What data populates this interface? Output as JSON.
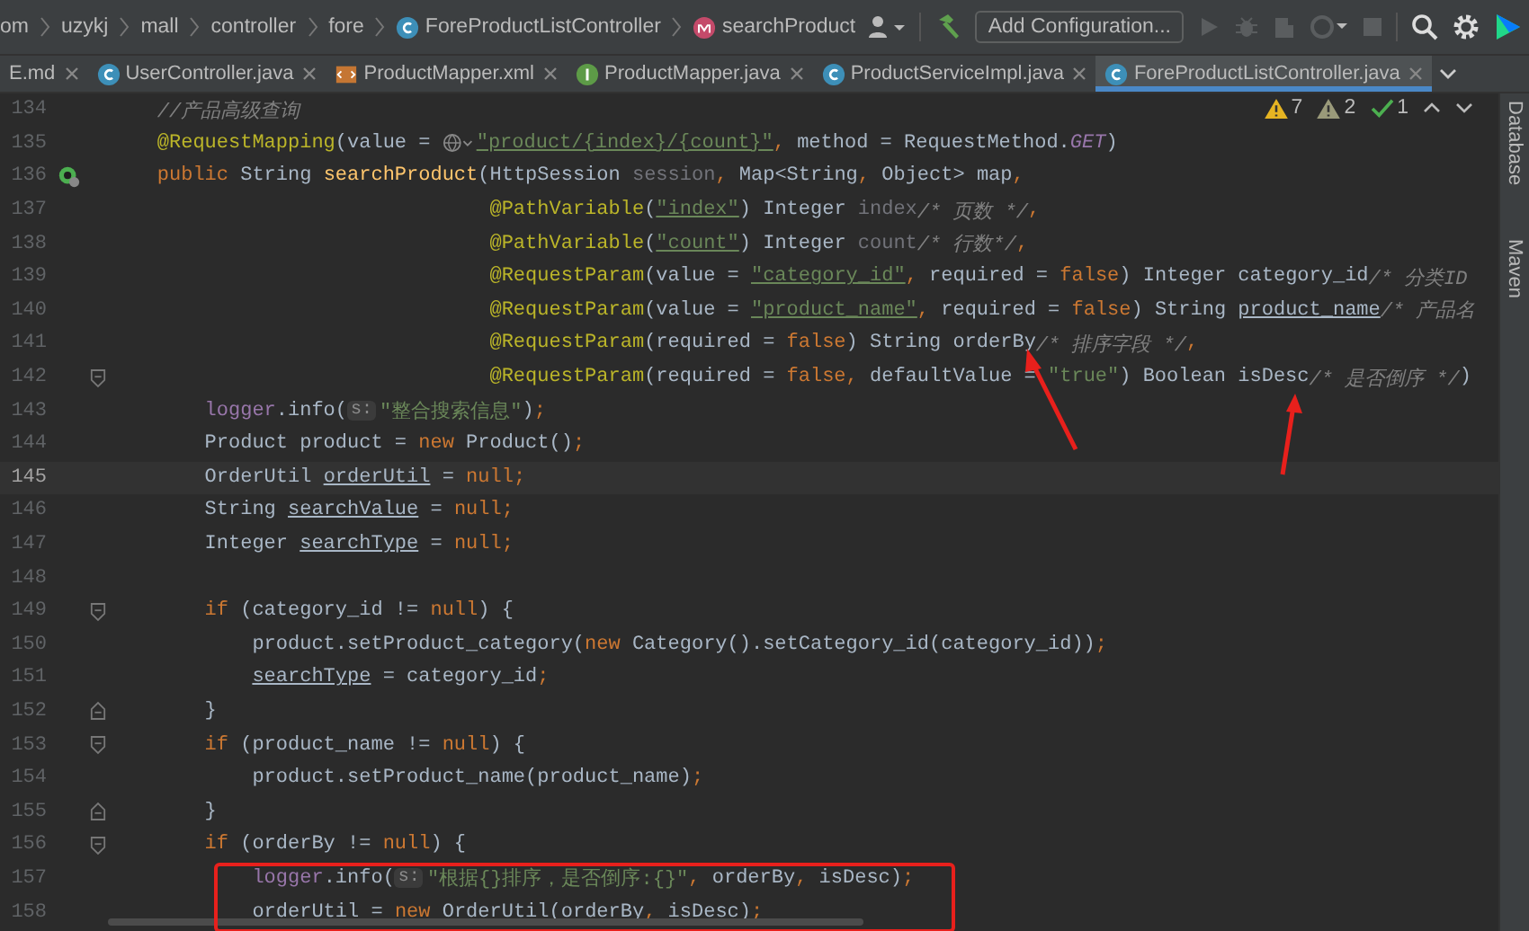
{
  "breadcrumbs": [
    {
      "text": "om",
      "kind": "folder"
    },
    {
      "text": "uzykj",
      "kind": "folder"
    },
    {
      "text": "mall",
      "kind": "folder"
    },
    {
      "text": "controller",
      "kind": "folder"
    },
    {
      "text": "fore",
      "kind": "folder"
    },
    {
      "text": "ForeProductListController",
      "kind": "class"
    },
    {
      "text": "searchProduct",
      "kind": "method"
    }
  ],
  "run_config": {
    "label": "Add Configuration..."
  },
  "tabs": [
    {
      "label": "E.md",
      "kind": "text",
      "selected": false
    },
    {
      "label": "UserController.java",
      "kind": "class",
      "selected": false
    },
    {
      "label": "ProductMapper.xml",
      "kind": "xml",
      "selected": false
    },
    {
      "label": "ProductMapper.java",
      "kind": "interface",
      "selected": false
    },
    {
      "label": "ProductServiceImpl.java",
      "kind": "class",
      "selected": false
    },
    {
      "label": "ForeProductListController.java",
      "kind": "class",
      "selected": true
    }
  ],
  "inspections": [
    {
      "kind": "warning",
      "count": "7"
    },
    {
      "kind": "weak",
      "count": "2"
    },
    {
      "kind": "ok",
      "count": "1"
    }
  ],
  "side_tools": [
    "Database",
    "Maven"
  ],
  "lines": [
    {
      "number": "134",
      "current": false,
      "tokens": [
        {
          "kind": "member"
        },
        {
          "kind": "cmt",
          "text": "//产品高级查询"
        }
      ]
    },
    {
      "number": "135",
      "current": false,
      "tokens": [
        {
          "kind": "member"
        },
        {
          "kind": "ann",
          "text": "@RequestMapping"
        },
        {
          "kind": "p",
          "text": "(value = "
        },
        {
          "kind": "globe"
        },
        {
          "kind": "stru",
          "text": "\"product/{index}/{count}\""
        },
        {
          "kind": "kw",
          "text": ","
        },
        {
          "kind": "p",
          "text": " method = RequestMethod."
        },
        {
          "kind": "const",
          "text": "GET"
        },
        {
          "kind": "p",
          "text": ")"
        }
      ]
    },
    {
      "number": "136",
      "current": false,
      "kind": "bean",
      "tokens": [
        {
          "kind": "member"
        },
        {
          "kind": "kw",
          "text": "public"
        },
        {
          "kind": "p",
          "text": " String "
        },
        {
          "kind": "fn",
          "text": "searchProduct"
        },
        {
          "kind": "p",
          "text": "(HttpSession "
        },
        {
          "kind": "dim",
          "text": "session"
        },
        {
          "kind": "kw",
          "text": ","
        },
        {
          "kind": "p",
          "text": " Map<String"
        },
        {
          "kind": "kw",
          "text": ","
        },
        {
          "kind": "p",
          "text": " Object> map"
        },
        {
          "kind": "kw",
          "text": ","
        }
      ]
    },
    {
      "number": "137",
      "current": false,
      "tokens": [
        {
          "kind": "align"
        },
        {
          "kind": "ann",
          "text": "@PathVariable"
        },
        {
          "kind": "p",
          "text": "("
        },
        {
          "kind": "stru",
          "text": "\"index\""
        },
        {
          "kind": "p",
          "text": ") Integer "
        },
        {
          "kind": "dim",
          "text": "index"
        },
        {
          "kind": "cmt",
          "text": "/* 页数 */"
        },
        {
          "kind": "kw",
          "text": ","
        }
      ]
    },
    {
      "number": "138",
      "current": false,
      "tokens": [
        {
          "kind": "align"
        },
        {
          "kind": "ann",
          "text": "@PathVariable"
        },
        {
          "kind": "p",
          "text": "("
        },
        {
          "kind": "stru",
          "text": "\"count\""
        },
        {
          "kind": "p",
          "text": ") Integer "
        },
        {
          "kind": "dim",
          "text": "count"
        },
        {
          "kind": "cmt",
          "text": "/* 行数*/"
        },
        {
          "kind": "kw",
          "text": ","
        }
      ]
    },
    {
      "number": "139",
      "current": false,
      "tokens": [
        {
          "kind": "align"
        },
        {
          "kind": "ann",
          "text": "@RequestParam"
        },
        {
          "kind": "p",
          "text": "(value = "
        },
        {
          "kind": "stru",
          "text": "\"category_id\""
        },
        {
          "kind": "kw",
          "text": ","
        },
        {
          "kind": "p",
          "text": " required = "
        },
        {
          "kind": "kw",
          "text": "false"
        },
        {
          "kind": "p",
          "text": ") Integer category_id"
        },
        {
          "kind": "cmt",
          "text": "/* 分类ID"
        }
      ]
    },
    {
      "number": "140",
      "current": false,
      "tokens": [
        {
          "kind": "align"
        },
        {
          "kind": "ann",
          "text": "@RequestParam"
        },
        {
          "kind": "p",
          "text": "(value = "
        },
        {
          "kind": "stru",
          "text": "\"product_name\""
        },
        {
          "kind": "kw",
          "text": ","
        },
        {
          "kind": "p",
          "text": " required = "
        },
        {
          "kind": "kw",
          "text": "false"
        },
        {
          "kind": "p",
          "text": ") String "
        },
        {
          "kind": "pu",
          "text": "product_name"
        },
        {
          "kind": "cmt",
          "text": "/* 产品名"
        }
      ]
    },
    {
      "number": "141",
      "current": false,
      "tokens": [
        {
          "kind": "align"
        },
        {
          "kind": "ann",
          "text": "@RequestParam"
        },
        {
          "kind": "p",
          "text": "(required = "
        },
        {
          "kind": "kw",
          "text": "false"
        },
        {
          "kind": "p",
          "text": ") String orderBy"
        },
        {
          "kind": "cmt",
          "text": "/* 排序字段 */"
        },
        {
          "kind": "kw",
          "text": ","
        }
      ]
    },
    {
      "number": "142",
      "current": false,
      "kind": "fold-start",
      "tokens": [
        {
          "kind": "align"
        },
        {
          "kind": "ann",
          "text": "@RequestParam"
        },
        {
          "kind": "p",
          "text": "(required = "
        },
        {
          "kind": "kw",
          "text": "false,"
        },
        {
          "kind": "p",
          "text": " defaultValue = "
        },
        {
          "kind": "str",
          "text": "\"true\""
        },
        {
          "kind": "p",
          "text": ") Boolean isDesc"
        },
        {
          "kind": "cmt",
          "text": "/* 是否倒序 */"
        },
        {
          "kind": "p",
          "text": ")"
        }
      ]
    },
    {
      "number": "143",
      "current": false,
      "tokens": [
        {
          "kind": "body"
        },
        {
          "kind": "fld",
          "text": "logger"
        },
        {
          "kind": "p",
          "text": ".info("
        },
        {
          "kind": "hint",
          "text": "s:"
        },
        {
          "kind": "str",
          "text": "\"整合搜索信息\""
        },
        {
          "kind": "p",
          "text": ")"
        },
        {
          "kind": "kw",
          "text": ";"
        }
      ]
    },
    {
      "number": "144",
      "current": false,
      "tokens": [
        {
          "kind": "body"
        },
        {
          "kind": "p",
          "text": "Product product = "
        },
        {
          "kind": "kw",
          "text": "new"
        },
        {
          "kind": "p",
          "text": " Product()"
        },
        {
          "kind": "kw",
          "text": ";"
        }
      ]
    },
    {
      "number": "145",
      "current": true,
      "tokens": [
        {
          "kind": "body"
        },
        {
          "kind": "p",
          "text": "OrderUtil "
        },
        {
          "kind": "pu",
          "text": "orderUtil"
        },
        {
          "kind": "p",
          "text": " = "
        },
        {
          "kind": "kw",
          "text": "null;"
        }
      ]
    },
    {
      "number": "146",
      "current": false,
      "tokens": [
        {
          "kind": "body"
        },
        {
          "kind": "p",
          "text": "String "
        },
        {
          "kind": "pu",
          "text": "searchValue"
        },
        {
          "kind": "p",
          "text": " = "
        },
        {
          "kind": "kw",
          "text": "null;"
        }
      ]
    },
    {
      "number": "147",
      "current": false,
      "tokens": [
        {
          "kind": "body"
        },
        {
          "kind": "p",
          "text": "Integer "
        },
        {
          "kind": "pu",
          "text": "searchType"
        },
        {
          "kind": "p",
          "text": " = "
        },
        {
          "kind": "kw",
          "text": "null;"
        }
      ]
    },
    {
      "number": "148",
      "current": false
    },
    {
      "number": "149",
      "current": false,
      "kind": "fold-start",
      "tokens": [
        {
          "kind": "body"
        },
        {
          "kind": "kw",
          "text": "if"
        },
        {
          "kind": "p",
          "text": " (category_id != "
        },
        {
          "kind": "kw",
          "text": "null"
        },
        {
          "kind": "p",
          "text": ") {"
        }
      ]
    },
    {
      "number": "150",
      "current": false,
      "tokens": [
        {
          "kind": "block"
        },
        {
          "kind": "p",
          "text": "product.setProduct_category("
        },
        {
          "kind": "kw",
          "text": "new"
        },
        {
          "kind": "p",
          "text": " Category().setCategory_id(category_id))"
        },
        {
          "kind": "kw",
          "text": ";"
        }
      ]
    },
    {
      "number": "151",
      "current": false,
      "tokens": [
        {
          "kind": "block"
        },
        {
          "kind": "pu",
          "text": "searchType"
        },
        {
          "kind": "p",
          "text": " = category_id"
        },
        {
          "kind": "kw",
          "text": ";"
        }
      ]
    },
    {
      "number": "152",
      "current": false,
      "kind": "fold-end",
      "tokens": [
        {
          "kind": "body"
        },
        {
          "kind": "p",
          "text": "}"
        }
      ]
    },
    {
      "number": "153",
      "current": false,
      "kind": "fold-start",
      "tokens": [
        {
          "kind": "body"
        },
        {
          "kind": "kw",
          "text": "if"
        },
        {
          "kind": "p",
          "text": " (product_name != "
        },
        {
          "kind": "kw",
          "text": "null"
        },
        {
          "kind": "p",
          "text": ") {"
        }
      ]
    },
    {
      "number": "154",
      "current": false,
      "tokens": [
        {
          "kind": "block"
        },
        {
          "kind": "p",
          "text": "product.setProduct_name(product_name)"
        },
        {
          "kind": "kw",
          "text": ";"
        }
      ]
    },
    {
      "number": "155",
      "current": false,
      "kind": "fold-end",
      "tokens": [
        {
          "kind": "body"
        },
        {
          "kind": "p",
          "text": "}"
        }
      ]
    },
    {
      "number": "156",
      "current": false,
      "kind": "fold-start",
      "tokens": [
        {
          "kind": "body"
        },
        {
          "kind": "kw",
          "text": "if"
        },
        {
          "kind": "p",
          "text": " (orderBy != "
        },
        {
          "kind": "kw",
          "text": "null"
        },
        {
          "kind": "p",
          "text": ") {"
        }
      ]
    },
    {
      "number": "157",
      "current": false,
      "tokens": [
        {
          "kind": "block"
        },
        {
          "kind": "fld",
          "text": "logger"
        },
        {
          "kind": "p",
          "text": ".info("
        },
        {
          "kind": "hint",
          "text": "s:"
        },
        {
          "kind": "str",
          "text": "\"根据{}排序，是否倒序:{}\""
        },
        {
          "kind": "kw",
          "text": ","
        },
        {
          "kind": "p",
          "text": " orderBy"
        },
        {
          "kind": "kw",
          "text": ","
        },
        {
          "kind": "p",
          "text": " isDesc)"
        },
        {
          "kind": "kw",
          "text": ";"
        }
      ]
    },
    {
      "number": "158",
      "current": false,
      "tokens": [
        {
          "kind": "block"
        },
        {
          "kind": "pu",
          "text": "orderUtil"
        },
        {
          "kind": "p",
          "text": " = "
        },
        {
          "kind": "kw",
          "text": "new"
        },
        {
          "kind": "p",
          "text": " OrderUtil(orderBy"
        },
        {
          "kind": "kw",
          "text": ","
        },
        {
          "kind": "p",
          "text": " isDesc)"
        },
        {
          "kind": "kw",
          "text": ";"
        }
      ]
    }
  ]
}
